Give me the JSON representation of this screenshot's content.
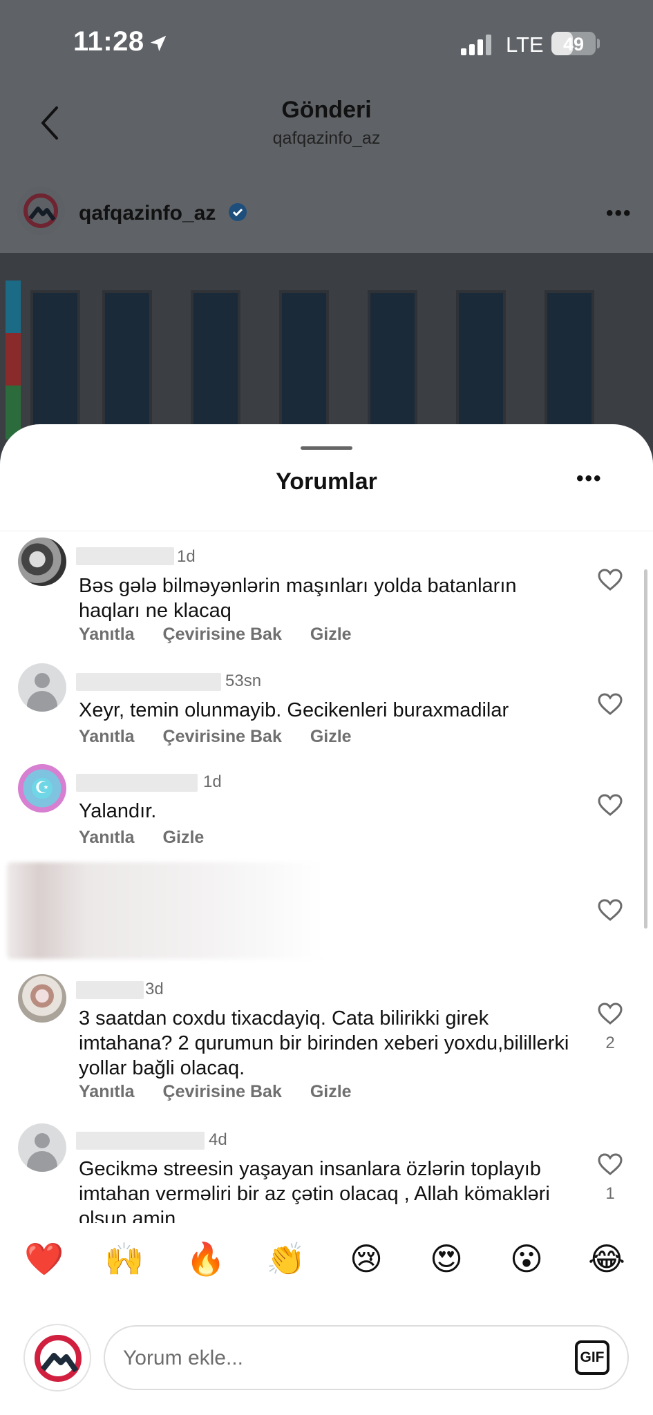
{
  "status_bar": {
    "time": "11:28",
    "network": "LTE",
    "battery": "49",
    "battery_fraction": 0.49
  },
  "header": {
    "title": "Gönderi",
    "subtitle": "qafqazinfo_az"
  },
  "post": {
    "author": "qafqazinfo_az"
  },
  "sheet": {
    "title": "Yorumlar"
  },
  "comments": [
    {
      "time": "1d",
      "text": "Bəs gələ bilməyənlərin maşınları yolda batanların haqları ne klacaq",
      "actions": [
        "Yanıtla",
        "Çevirisine Bak",
        "Gizle"
      ],
      "likes": ""
    },
    {
      "time": "53sn",
      "text": "Xeyr, temin olunmayib. Gecikenleri buraxmadilar",
      "actions": [
        "Yanıtla",
        "Çevirisine Bak",
        "Gizle"
      ],
      "likes": ""
    },
    {
      "time": "1d",
      "text": "Yalandır.",
      "actions": [
        "Yanıtla",
        "Gizle"
      ],
      "likes": ""
    },
    {
      "time": "",
      "text": "",
      "actions": [],
      "likes": ""
    },
    {
      "time": "3d",
      "text": "3 saatdan coxdu tixacdayiq. Cata bilirikki girek imtahana? 2 qurumun bir birinden xeberi yoxdu,bilillerki yollar bağli olacaq.",
      "actions": [
        "Yanıtla",
        "Çevirisine Bak",
        "Gizle"
      ],
      "likes": "2"
    },
    {
      "time": "4d",
      "text": "Gecikmə streesin yaşayan insanlara özlərin toplayıb imtahan verməliri bir az çətin olacaq , Allah kömakləri olsun amin",
      "actions": [],
      "likes": "1"
    }
  ],
  "emojis": [
    "❤️",
    "🙌",
    "🔥",
    "👏",
    "😢",
    "😍",
    "😮",
    "😂"
  ],
  "input": {
    "placeholder": "Yorum ekle...",
    "gif_label": "GIF"
  },
  "colors": {
    "accent_red": "#d11f3f",
    "brand_dark": "#1c2a3a",
    "verified_blue": "#1d72d6"
  }
}
